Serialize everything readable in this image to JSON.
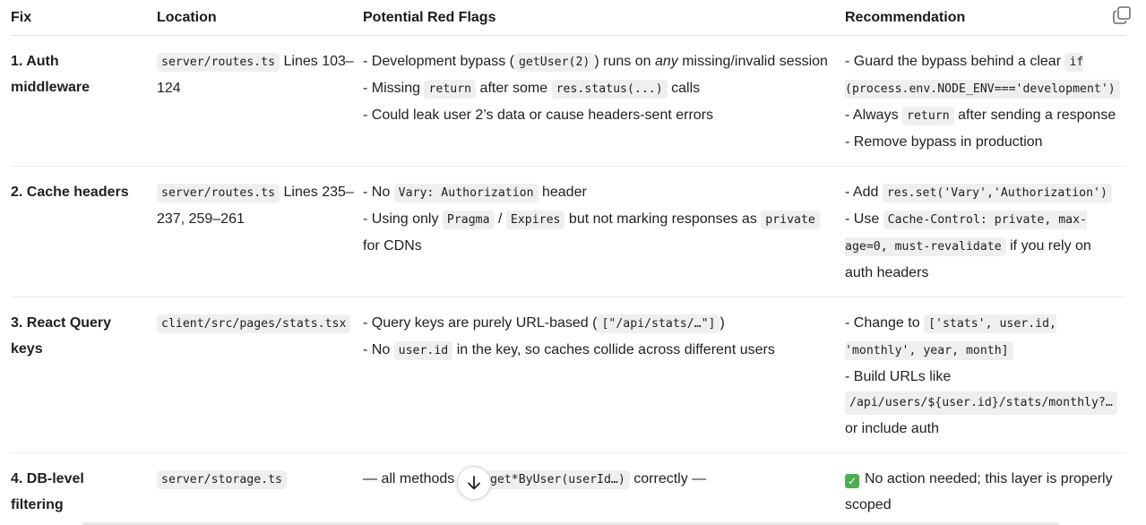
{
  "header": {
    "fix": "Fix",
    "location": "Location",
    "flags": "Potential Red Flags",
    "recommendation": "Recommendation"
  },
  "icons": {
    "copy": "copy-icon",
    "scroll": "arrow-down-icon",
    "check": "check-mark-icon"
  },
  "rows": [
    {
      "fix": "1. Auth middleware",
      "location": {
        "code": "server/routes.ts",
        "text": " Lines 103–124"
      },
      "flags": {
        "l1a": "- Development bypass (",
        "l1code": "getUser(2)",
        "l1b": ") runs on ",
        "l1em": "any",
        "l1c": " missing/invalid session",
        "l2a": "- Missing ",
        "l2code": "return",
        "l2b": " after some ",
        "l2code2": "res.status(...)",
        "l2c": " calls",
        "l3": "- Could leak user 2’s data or cause headers-sent errors"
      },
      "rec": {
        "l1a": "- Guard the bypass behind a clear ",
        "l1code": "if (process.env.NODE_ENV==='development')",
        "l2a": "- Always ",
        "l2code": "return",
        "l2b": " after sending a response",
        "l3": "- Remove bypass in production"
      }
    },
    {
      "fix": "2. Cache headers",
      "location": {
        "code": "server/routes.ts",
        "text": " Lines 235–237, 259–261"
      },
      "flags": {
        "l1a": "- No ",
        "l1code": "Vary: Authorization",
        "l1b": " header",
        "l2a": "- Using only ",
        "l2code": "Pragma",
        "l2b": " / ",
        "l2code2": "Expires",
        "l2c": " but not marking responses as ",
        "l2code3": "private",
        "l2d": " for CDNs"
      },
      "rec": {
        "l1a": "- Add ",
        "l1code": "res.set('Vary','Authorization')",
        "l2a": "- Use ",
        "l2code": "Cache-Control: private, max-age=0, must-revalidate",
        "l2b": " if you rely on auth headers"
      }
    },
    {
      "fix": "3. React Query keys",
      "location": {
        "code": "client/src/pages/stats.tsx",
        "text": ""
      },
      "flags": {
        "l1a": "- Query keys are purely URL-based (",
        "l1code": "[\"/api/stats/…\"]",
        "l1b": ")",
        "l2a": "- No ",
        "l2code": "user.id",
        "l2b": " in the key, so caches collide across different users"
      },
      "rec": {
        "l1a": "- Change to ",
        "l1code": "['stats', user.id, 'monthly', year, month]",
        "l2a": "- Build URLs like ",
        "l2code": "/api/users/${user.id}/stats/monthly?…",
        "l2b": " or include auth"
      }
    },
    {
      "fix": "4. DB-level filtering",
      "location": {
        "code": "server/storage.ts",
        "text": ""
      },
      "flags": {
        "l1a": "— all methods use ",
        "l1code": "get*ByUser(userId…)",
        "l1b": " correctly —"
      },
      "rec": {
        "l1a": "No action needed; this layer is properly scoped"
      }
    }
  ]
}
